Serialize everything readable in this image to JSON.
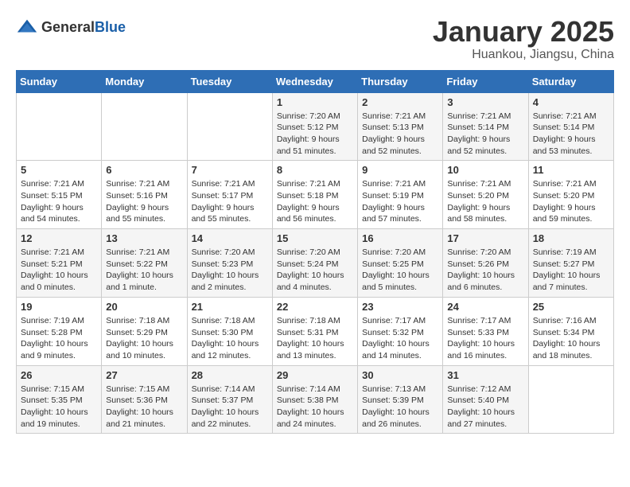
{
  "header": {
    "logo_general": "General",
    "logo_blue": "Blue",
    "title": "January 2025",
    "subtitle": "Huankou, Jiangsu, China"
  },
  "weekdays": [
    "Sunday",
    "Monday",
    "Tuesday",
    "Wednesday",
    "Thursday",
    "Friday",
    "Saturday"
  ],
  "weeks": [
    [
      {
        "day": "",
        "sunrise": "",
        "sunset": "",
        "daylight": ""
      },
      {
        "day": "",
        "sunrise": "",
        "sunset": "",
        "daylight": ""
      },
      {
        "day": "",
        "sunrise": "",
        "sunset": "",
        "daylight": ""
      },
      {
        "day": "1",
        "sunrise": "Sunrise: 7:20 AM",
        "sunset": "Sunset: 5:12 PM",
        "daylight": "Daylight: 9 hours and 51 minutes."
      },
      {
        "day": "2",
        "sunrise": "Sunrise: 7:21 AM",
        "sunset": "Sunset: 5:13 PM",
        "daylight": "Daylight: 9 hours and 52 minutes."
      },
      {
        "day": "3",
        "sunrise": "Sunrise: 7:21 AM",
        "sunset": "Sunset: 5:14 PM",
        "daylight": "Daylight: 9 hours and 52 minutes."
      },
      {
        "day": "4",
        "sunrise": "Sunrise: 7:21 AM",
        "sunset": "Sunset: 5:14 PM",
        "daylight": "Daylight: 9 hours and 53 minutes."
      }
    ],
    [
      {
        "day": "5",
        "sunrise": "Sunrise: 7:21 AM",
        "sunset": "Sunset: 5:15 PM",
        "daylight": "Daylight: 9 hours and 54 minutes."
      },
      {
        "day": "6",
        "sunrise": "Sunrise: 7:21 AM",
        "sunset": "Sunset: 5:16 PM",
        "daylight": "Daylight: 9 hours and 55 minutes."
      },
      {
        "day": "7",
        "sunrise": "Sunrise: 7:21 AM",
        "sunset": "Sunset: 5:17 PM",
        "daylight": "Daylight: 9 hours and 55 minutes."
      },
      {
        "day": "8",
        "sunrise": "Sunrise: 7:21 AM",
        "sunset": "Sunset: 5:18 PM",
        "daylight": "Daylight: 9 hours and 56 minutes."
      },
      {
        "day": "9",
        "sunrise": "Sunrise: 7:21 AM",
        "sunset": "Sunset: 5:19 PM",
        "daylight": "Daylight: 9 hours and 57 minutes."
      },
      {
        "day": "10",
        "sunrise": "Sunrise: 7:21 AM",
        "sunset": "Sunset: 5:20 PM",
        "daylight": "Daylight: 9 hours and 58 minutes."
      },
      {
        "day": "11",
        "sunrise": "Sunrise: 7:21 AM",
        "sunset": "Sunset: 5:20 PM",
        "daylight": "Daylight: 9 hours and 59 minutes."
      }
    ],
    [
      {
        "day": "12",
        "sunrise": "Sunrise: 7:21 AM",
        "sunset": "Sunset: 5:21 PM",
        "daylight": "Daylight: 10 hours and 0 minutes."
      },
      {
        "day": "13",
        "sunrise": "Sunrise: 7:21 AM",
        "sunset": "Sunset: 5:22 PM",
        "daylight": "Daylight: 10 hours and 1 minute."
      },
      {
        "day": "14",
        "sunrise": "Sunrise: 7:20 AM",
        "sunset": "Sunset: 5:23 PM",
        "daylight": "Daylight: 10 hours and 2 minutes."
      },
      {
        "day": "15",
        "sunrise": "Sunrise: 7:20 AM",
        "sunset": "Sunset: 5:24 PM",
        "daylight": "Daylight: 10 hours and 4 minutes."
      },
      {
        "day": "16",
        "sunrise": "Sunrise: 7:20 AM",
        "sunset": "Sunset: 5:25 PM",
        "daylight": "Daylight: 10 hours and 5 minutes."
      },
      {
        "day": "17",
        "sunrise": "Sunrise: 7:20 AM",
        "sunset": "Sunset: 5:26 PM",
        "daylight": "Daylight: 10 hours and 6 minutes."
      },
      {
        "day": "18",
        "sunrise": "Sunrise: 7:19 AM",
        "sunset": "Sunset: 5:27 PM",
        "daylight": "Daylight: 10 hours and 7 minutes."
      }
    ],
    [
      {
        "day": "19",
        "sunrise": "Sunrise: 7:19 AM",
        "sunset": "Sunset: 5:28 PM",
        "daylight": "Daylight: 10 hours and 9 minutes."
      },
      {
        "day": "20",
        "sunrise": "Sunrise: 7:18 AM",
        "sunset": "Sunset: 5:29 PM",
        "daylight": "Daylight: 10 hours and 10 minutes."
      },
      {
        "day": "21",
        "sunrise": "Sunrise: 7:18 AM",
        "sunset": "Sunset: 5:30 PM",
        "daylight": "Daylight: 10 hours and 12 minutes."
      },
      {
        "day": "22",
        "sunrise": "Sunrise: 7:18 AM",
        "sunset": "Sunset: 5:31 PM",
        "daylight": "Daylight: 10 hours and 13 minutes."
      },
      {
        "day": "23",
        "sunrise": "Sunrise: 7:17 AM",
        "sunset": "Sunset: 5:32 PM",
        "daylight": "Daylight: 10 hours and 14 minutes."
      },
      {
        "day": "24",
        "sunrise": "Sunrise: 7:17 AM",
        "sunset": "Sunset: 5:33 PM",
        "daylight": "Daylight: 10 hours and 16 minutes."
      },
      {
        "day": "25",
        "sunrise": "Sunrise: 7:16 AM",
        "sunset": "Sunset: 5:34 PM",
        "daylight": "Daylight: 10 hours and 18 minutes."
      }
    ],
    [
      {
        "day": "26",
        "sunrise": "Sunrise: 7:15 AM",
        "sunset": "Sunset: 5:35 PM",
        "daylight": "Daylight: 10 hours and 19 minutes."
      },
      {
        "day": "27",
        "sunrise": "Sunrise: 7:15 AM",
        "sunset": "Sunset: 5:36 PM",
        "daylight": "Daylight: 10 hours and 21 minutes."
      },
      {
        "day": "28",
        "sunrise": "Sunrise: 7:14 AM",
        "sunset": "Sunset: 5:37 PM",
        "daylight": "Daylight: 10 hours and 22 minutes."
      },
      {
        "day": "29",
        "sunrise": "Sunrise: 7:14 AM",
        "sunset": "Sunset: 5:38 PM",
        "daylight": "Daylight: 10 hours and 24 minutes."
      },
      {
        "day": "30",
        "sunrise": "Sunrise: 7:13 AM",
        "sunset": "Sunset: 5:39 PM",
        "daylight": "Daylight: 10 hours and 26 minutes."
      },
      {
        "day": "31",
        "sunrise": "Sunrise: 7:12 AM",
        "sunset": "Sunset: 5:40 PM",
        "daylight": "Daylight: 10 hours and 27 minutes."
      },
      {
        "day": "",
        "sunrise": "",
        "sunset": "",
        "daylight": ""
      }
    ]
  ]
}
